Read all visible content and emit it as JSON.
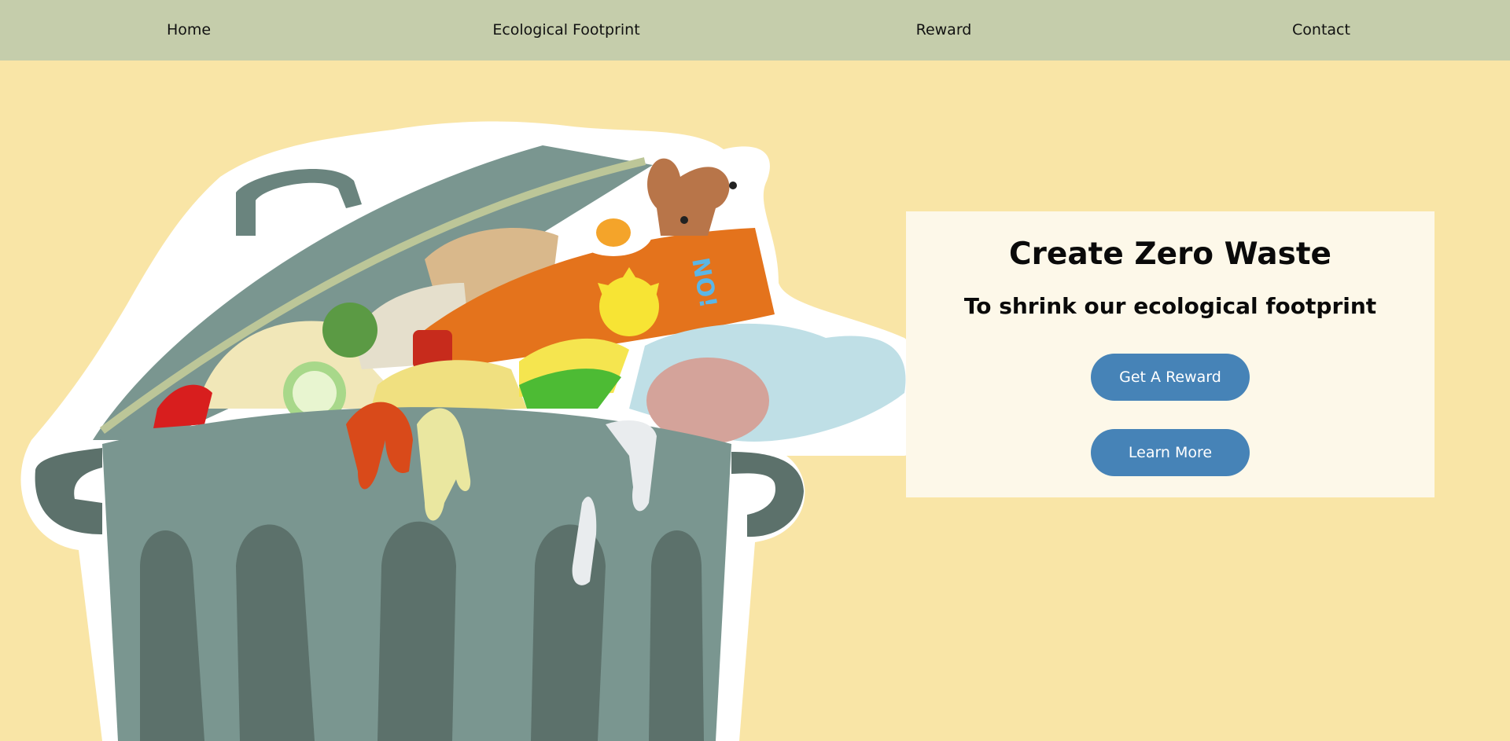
{
  "nav": {
    "items": [
      {
        "label": "Home"
      },
      {
        "label": "Ecological Footprint"
      },
      {
        "label": "Reward"
      },
      {
        "label": "Contact"
      }
    ]
  },
  "hero": {
    "title": "Create Zero Waste",
    "subtitle": "To shrink our ecological footprint",
    "primary_button": "Get A Reward",
    "secondary_button": "Learn More",
    "illustration": {
      "name": "overflowing-trash-can-illustration",
      "can_lettering": "NO!"
    }
  },
  "colors": {
    "page_background": "#f9e5a6",
    "nav_background": "#c5cdab",
    "card_background": "#fdf8e9",
    "button_background": "#4683b7",
    "button_text": "#ffffff",
    "trash_can": "#7a9690",
    "trash_can_dark": "#5c716b"
  }
}
